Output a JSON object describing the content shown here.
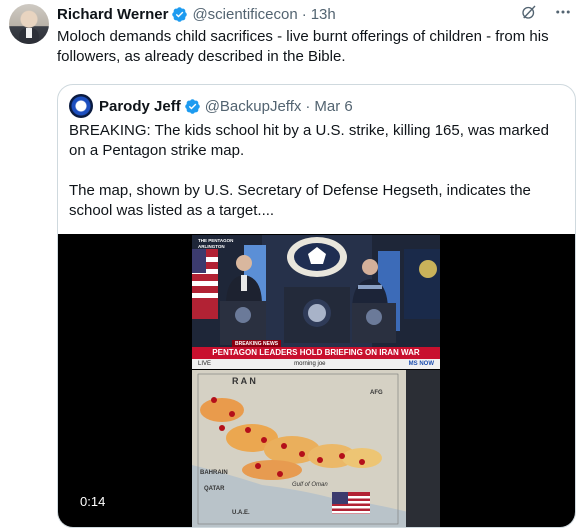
{
  "tweet": {
    "author_name": "Richard Werner",
    "handle": "@scientificecon",
    "separator": "·",
    "time": "13h",
    "text": "Moloch demands child sacrifices - live burnt offerings of children - from his followers, as already described in the Bible.",
    "icons": [
      "grok-icon",
      "more-icon",
      "verified-icon"
    ]
  },
  "quote": {
    "author_name": "Parody Jeff",
    "handle": "@BackupJeffx",
    "separator": "·",
    "date": "Mar 6",
    "paragraph1": "BREAKING: The kids school hit by a U.S. strike, killing 165, was marked on a Pentagon strike map.",
    "paragraph2": "The map, shown by U.S. Secretary of Defense Hegseth, indicates the school was listed as a target....",
    "video": {
      "duration": "0:14",
      "breaking_tag": "BREAKING NEWS",
      "banner": "PENTAGON LEADERS HOLD BRIEFING ON IRAN WAR",
      "ticker_left": "LIVE",
      "ticker_mid": "morning joe",
      "ticker_right": "MS NOW",
      "corner_line1": "THE PENTAGON",
      "corner_line2": "ARLINGTON",
      "map_labels": [
        "R A N",
        "AFG",
        "BAHRAIN",
        "QATAR",
        "U.A.E.",
        "Gulf of Oman"
      ]
    }
  },
  "colors": {
    "text": "#0f1419",
    "secondary": "#536471",
    "verified_blue": "#1d9bf0",
    "border": "#cfd9de",
    "news_red": "#c8102e"
  }
}
